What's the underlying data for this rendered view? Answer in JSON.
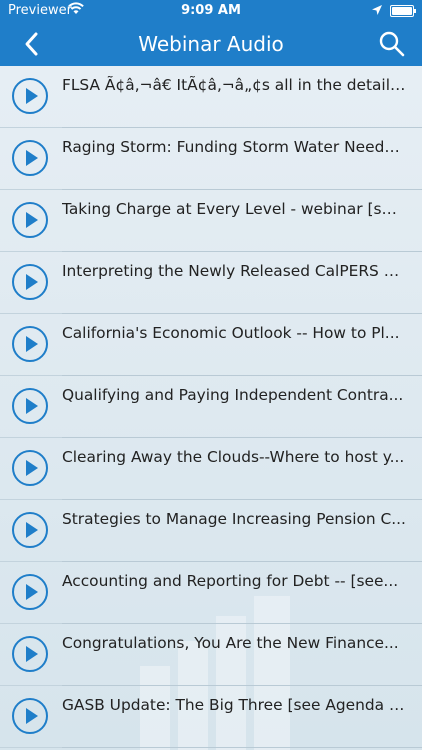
{
  "status": {
    "carrier": "Previewer",
    "time": "9:09 AM"
  },
  "nav": {
    "title": "Webinar Audio",
    "back_icon": "chevron-left-icon",
    "search_icon": "search-icon"
  },
  "colors": {
    "nav_bg": "#1f7ec9",
    "play_blue": "#1f7ec9"
  },
  "items": [
    {
      "label": "FLSA Ã¢â‚¬â€ ItÃ¢â‚¬â„¢s all in the details [pre..."
    },
    {
      "label": "Raging Storm: Funding Storm Water Needs..."
    },
    {
      "label": "Taking Charge at Every Level - webinar [see..."
    },
    {
      "label": "Interpreting the Newly Released CalPERS A..."
    },
    {
      "label": "California's Economic Outlook --  How to Pl..."
    },
    {
      "label": "Qualifying and Paying Independent Contra..."
    },
    {
      "label": "Clearing Away the Clouds--Where to host y..."
    },
    {
      "label": "Strategies to Manage Increasing Pension C..."
    },
    {
      "label": "Accounting and Reporting for Debt -- [see..."
    },
    {
      "label": "Congratulations, You Are the New Finance..."
    },
    {
      "label": "GASB Update: The Big Three [see Agenda p..."
    }
  ]
}
